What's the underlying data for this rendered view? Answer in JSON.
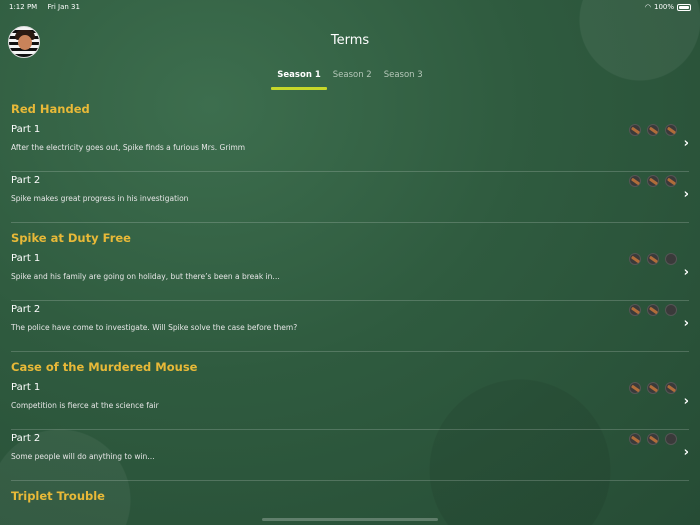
{
  "status": {
    "time": "1:12 PM",
    "date": "Fri Jan 31",
    "battery": "100%"
  },
  "header": {
    "title": "Terms"
  },
  "tabs": [
    {
      "label": "Season 1",
      "active": true
    },
    {
      "label": "Season 2",
      "active": false
    },
    {
      "label": "Season 3",
      "active": false
    }
  ],
  "sections": [
    {
      "title": "Red Handed",
      "episodes": [
        {
          "title": "Part 1",
          "desc": "After the electricity goes out, Spike finds a furious Mrs. Grimm",
          "badges": [
            1,
            1,
            1
          ]
        },
        {
          "title": "Part 2",
          "desc": "Spike makes great progress in his investigation",
          "badges": [
            1,
            1,
            1
          ]
        }
      ]
    },
    {
      "title": "Spike at Duty Free",
      "episodes": [
        {
          "title": "Part 1",
          "desc": "Spike and his family are going on holiday, but there’s been a break in…",
          "badges": [
            1,
            1,
            0
          ]
        },
        {
          "title": "Part 2",
          "desc": "The police have come to investigate. Will Spike solve the case before them?",
          "badges": [
            1,
            1,
            0
          ]
        }
      ]
    },
    {
      "title": "Case of the Murdered Mouse",
      "episodes": [
        {
          "title": "Part 1",
          "desc": "Competition is fierce at the science fair",
          "badges": [
            1,
            1,
            1
          ]
        },
        {
          "title": "Part 2",
          "desc": "Some people will do anything to win…",
          "badges": [
            1,
            1,
            0
          ]
        }
      ]
    },
    {
      "title": "Triplet Trouble",
      "episodes": []
    }
  ],
  "icons": {
    "chevron": "chevron-right-icon",
    "badge": "magnifier-badge-icon",
    "avatar": "avatar"
  }
}
